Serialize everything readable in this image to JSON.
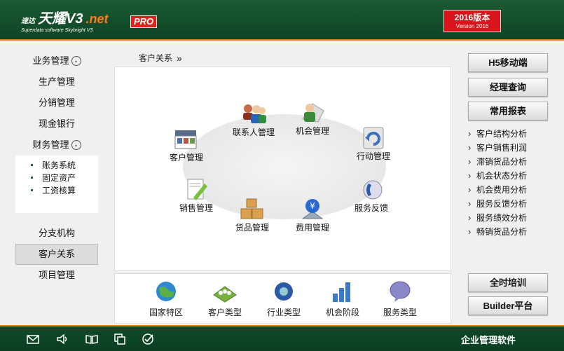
{
  "header": {
    "logo_brand": "速达",
    "logo_name": "天耀V3",
    "logo_suffix": ".net",
    "logo_tagline": "Superdata software Skybright V3",
    "pro_badge": "PRO",
    "version_title": "2016版本",
    "version_sub": "Version 2016"
  },
  "sidebar": {
    "items": [
      {
        "label": "业务管理"
      },
      {
        "label": "生产管理"
      },
      {
        "label": "分销管理"
      },
      {
        "label": "现金银行"
      },
      {
        "label": "财务管理"
      }
    ],
    "finance_sub": [
      "账务系统",
      "固定资产",
      "工资核算"
    ],
    "items_after": [
      {
        "label": "分支机构"
      },
      {
        "label": "客户关系"
      },
      {
        "label": "项目管理"
      }
    ]
  },
  "breadcrumb": {
    "label": "客户关系",
    "arrow": "»"
  },
  "modules": {
    "contacts": "联系人管理",
    "opportunity": "机会管理",
    "customer": "客户管理",
    "action": "行动管理",
    "sales": "销售管理",
    "service": "服务反馈",
    "goods": "货品管理",
    "expense": "费用管理"
  },
  "bottom_modules": [
    "国家特区",
    "客户类型",
    "行业类型",
    "机会阶段",
    "服务类型"
  ],
  "right_panel": {
    "buttons": [
      "H5移动端",
      "经理查询",
      "常用报表"
    ],
    "reports": [
      "客户结构分析",
      "客户销售利润",
      "滞销货品分析",
      "机会状态分析",
      "机会费用分析",
      "服务反馈分析",
      "服务绩效分析",
      "畅销货品分析"
    ],
    "bottom_buttons": [
      "全时培训",
      "Builder平台"
    ]
  },
  "footer": {
    "title": "企业管理软件"
  },
  "colors": {
    "header_green": "#1b5a33",
    "accent_orange": "#e2841e",
    "version_red": "#d9141b"
  }
}
